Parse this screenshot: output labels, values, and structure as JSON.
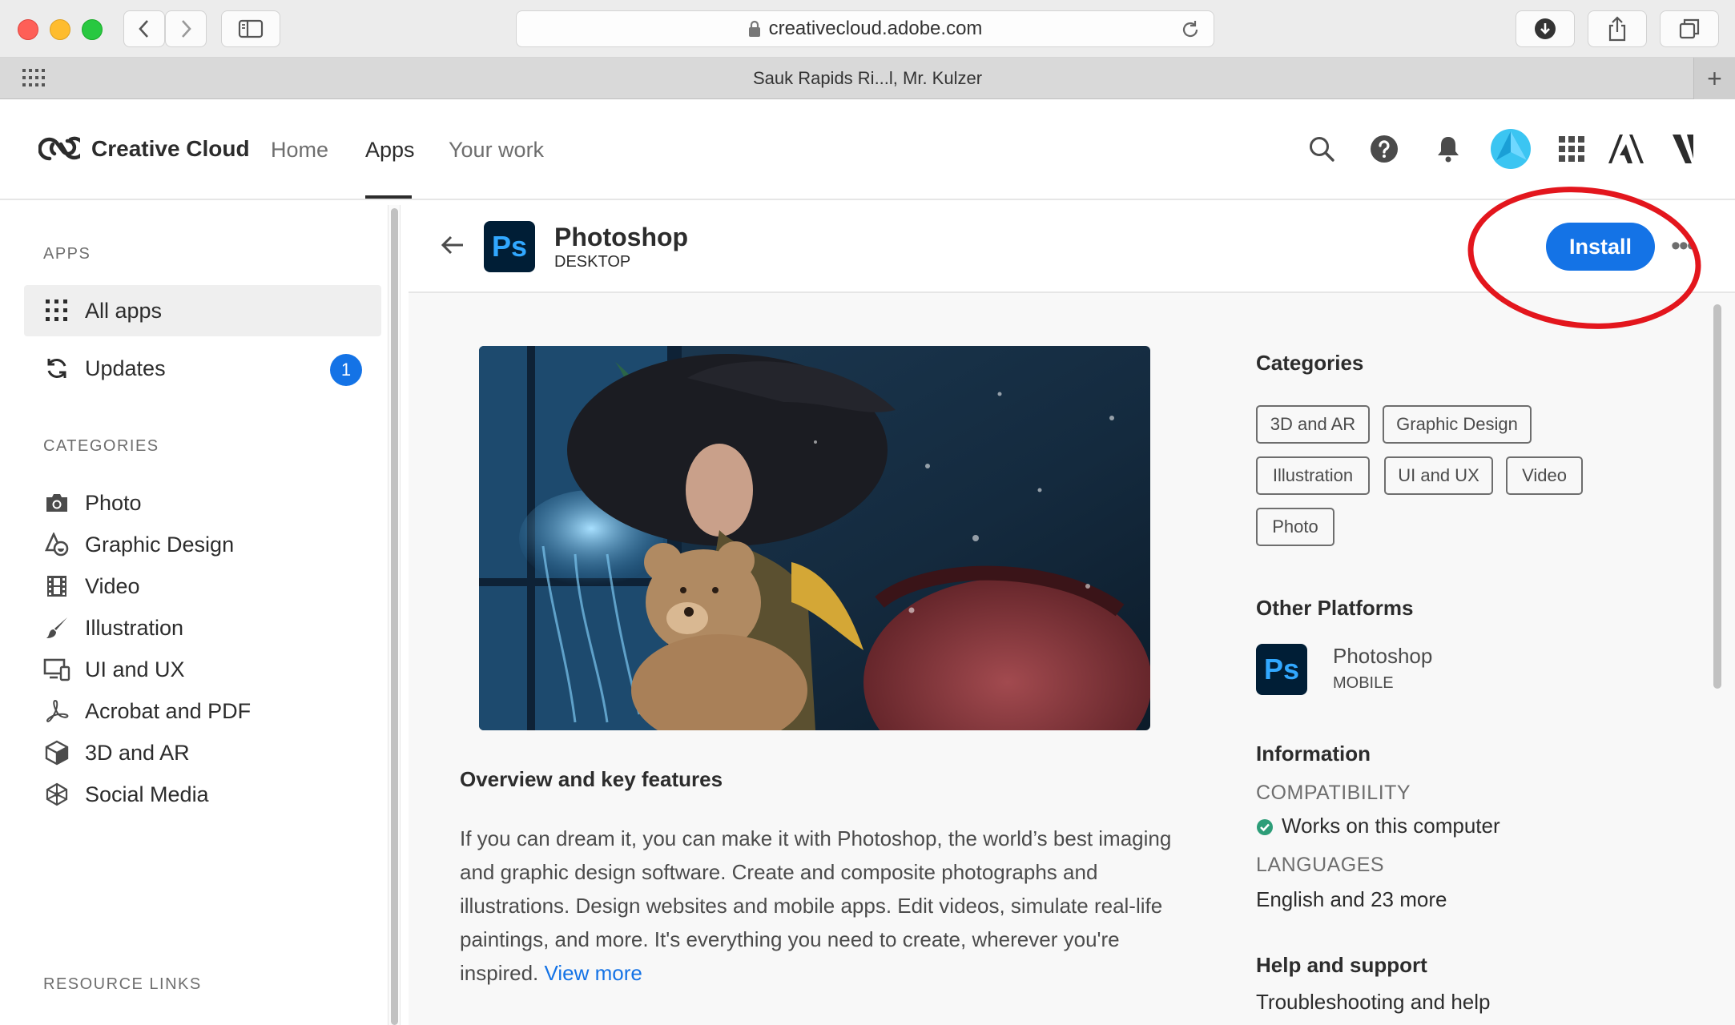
{
  "browser": {
    "url": "creativecloud.adobe.com",
    "tab_title": "Sauk Rapids Ri...l, Mr. Kulzer",
    "new_tab_symbol": "+"
  },
  "header": {
    "brand": "Creative Cloud",
    "nav": [
      {
        "label": "Home",
        "active": false
      },
      {
        "label": "Apps",
        "active": true
      },
      {
        "label": "Your work",
        "active": false
      }
    ],
    "icons": [
      "search-icon",
      "help-icon",
      "bell-icon",
      "avatar",
      "app-switcher-icon",
      "adobe-icon",
      "adobe-document-cloud-icon"
    ]
  },
  "sidebar": {
    "apps_heading": "APPS",
    "apps_items": [
      {
        "label": "All apps",
        "icon": "grid-icon",
        "active": true
      },
      {
        "label": "Updates",
        "icon": "refresh-icon",
        "badge": "1"
      }
    ],
    "categories_heading": "CATEGORIES",
    "categories": [
      {
        "label": "Photo",
        "icon": "camera-icon"
      },
      {
        "label": "Graphic Design",
        "icon": "shapes-icon"
      },
      {
        "label": "Video",
        "icon": "film-icon"
      },
      {
        "label": "Illustration",
        "icon": "brush-icon"
      },
      {
        "label": "UI and UX",
        "icon": "devices-icon"
      },
      {
        "label": "Acrobat and PDF",
        "icon": "acrobat-icon"
      },
      {
        "label": "3D and AR",
        "icon": "cube-icon"
      },
      {
        "label": "Social Media",
        "icon": "network-icon"
      }
    ],
    "resource_heading": "RESOURCE LINKS"
  },
  "app": {
    "icon_text": "Ps",
    "title": "Photoshop",
    "platform": "DESKTOP",
    "install_label": "Install",
    "more_label": "•••"
  },
  "overview": {
    "title": "Overview and key features",
    "text": "If you can dream it, you can make it with Photoshop, the world’s best imaging and graphic design software. Create and composite photographs and illustrations. Design websites and mobile apps. Edit videos, simulate real-life paintings, and more. It's everything you need to create, wherever you're inspired.",
    "link": "View more"
  },
  "details": {
    "categories_title": "Categories",
    "categories": [
      "3D and AR",
      "Graphic Design",
      "Illustration",
      "UI and UX",
      "Video",
      "Photo"
    ],
    "other_platforms_title": "Other Platforms",
    "other_platform": {
      "icon_text": "Ps",
      "name": "Photoshop",
      "platform": "MOBILE"
    },
    "information_title": "Information",
    "compatibility_label": "COMPATIBILITY",
    "compatibility_value": "Works on this computer",
    "languages_label": "LANGUAGES",
    "languages_value": "English and 23 more",
    "help_title": "Help and support",
    "help_link": "Troubleshooting and help"
  },
  "colors": {
    "accent": "#1473e6",
    "annotation_ring": "#e3161d",
    "ps_bg": "#001e36",
    "ps_fg": "#31a8ff",
    "check": "#2d9d78"
  }
}
